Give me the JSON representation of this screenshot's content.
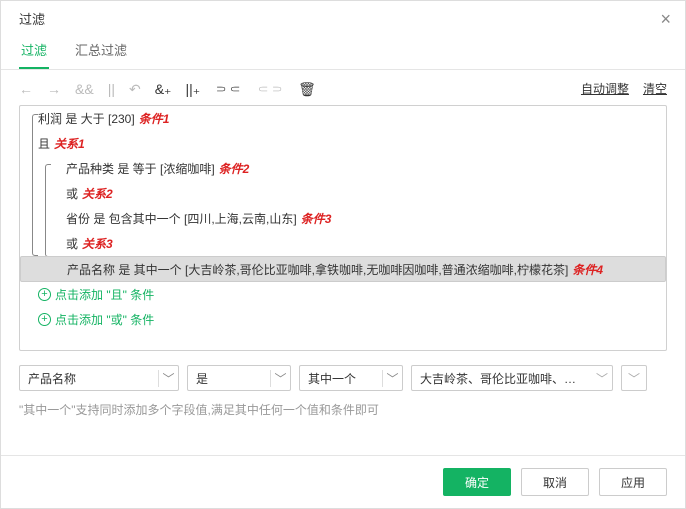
{
  "title": "过滤",
  "tabs": {
    "filter": "过滤",
    "summary": "汇总过滤"
  },
  "toolbar": {
    "auto": "自动调整",
    "clear": "清空"
  },
  "conditions": {
    "c1": "利润 是 大于 [230]",
    "c1_label": "条件1",
    "r1": "且",
    "r1_label": "关系1",
    "c2": "产品种类 是 等于 [浓缩咖啡]",
    "c2_label": "条件2",
    "r2": "或",
    "r2_label": "关系2",
    "c3": "省份 是 包含其中一个 [四川,上海,云南,山东]",
    "c3_label": "条件3",
    "r3": "或",
    "r3_label": "关系3",
    "c4": "产品名称 是 其中一个 [大吉岭茶,哥伦比亚咖啡,拿铁咖啡,无咖啡因咖啡,普通浓缩咖啡,柠檬花茶]",
    "c4_label": "条件4",
    "add_and": "点击添加 \"且\" 条件",
    "add_or": "点击添加 \"或\" 条件"
  },
  "form": {
    "field": "产品名称",
    "verb": "是",
    "op": "其中一个",
    "value": "大吉岭茶、哥伦比亚咖啡、拿铁"
  },
  "hint": "\"其中一个\"支持同时添加多个字段值,满足其中任何一个值和条件即可",
  "footer": {
    "ok": "确定",
    "cancel": "取消",
    "apply": "应用"
  }
}
